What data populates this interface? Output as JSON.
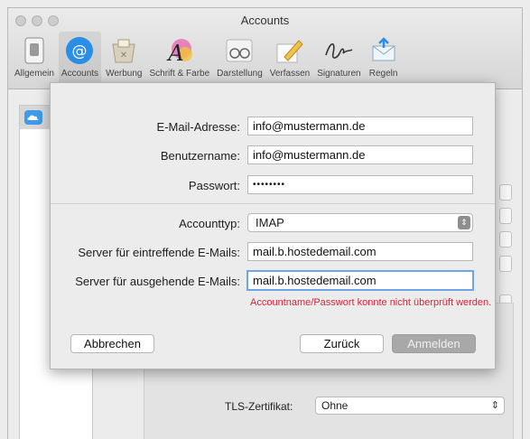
{
  "window": {
    "title": "Accounts"
  },
  "toolbar": {
    "items": [
      {
        "label": "Allgemein",
        "icon": "general-switch-icon"
      },
      {
        "label": "Accounts",
        "icon": "at-sign-icon",
        "active": true
      },
      {
        "label": "Werbung",
        "icon": "junk-mail-icon"
      },
      {
        "label": "Schrift & Farbe",
        "icon": "font-color-icon"
      },
      {
        "label": "Darstellung",
        "icon": "glasses-icon"
      },
      {
        "label": "Verfassen",
        "icon": "pencil-icon"
      },
      {
        "label": "Signaturen",
        "icon": "signature-icon"
      },
      {
        "label": "Regeln",
        "icon": "rules-envelope-icon"
      }
    ]
  },
  "sheet": {
    "email_label": "E-Mail-Adresse:",
    "email_value": "info@mustermann.de",
    "username_label": "Benutzername:",
    "username_value": "info@mustermann.de",
    "password_label": "Passwort:",
    "password_value": "••••••••",
    "account_type_label": "Accounttyp:",
    "account_type_value": "IMAP",
    "incoming_label": "Server für eintreffende E-Mails:",
    "incoming_value": "mail.b.hostedemail.com",
    "outgoing_label": "Server für ausgehende E-Mails:",
    "outgoing_value": "mail.b.hostedemail.com",
    "error_text": "Accountname/Passwort konnte nicht überprüft werden.",
    "cancel_label": "Abbrechen",
    "back_label": "Zurück",
    "signin_label": "Anmelden"
  },
  "background": {
    "tls_label": "TLS-Zertifikat:",
    "tls_value": "Ohne"
  },
  "colors": {
    "accent": "#2a8de6",
    "error": "#d0263a",
    "focus": "#6ea5e6"
  }
}
